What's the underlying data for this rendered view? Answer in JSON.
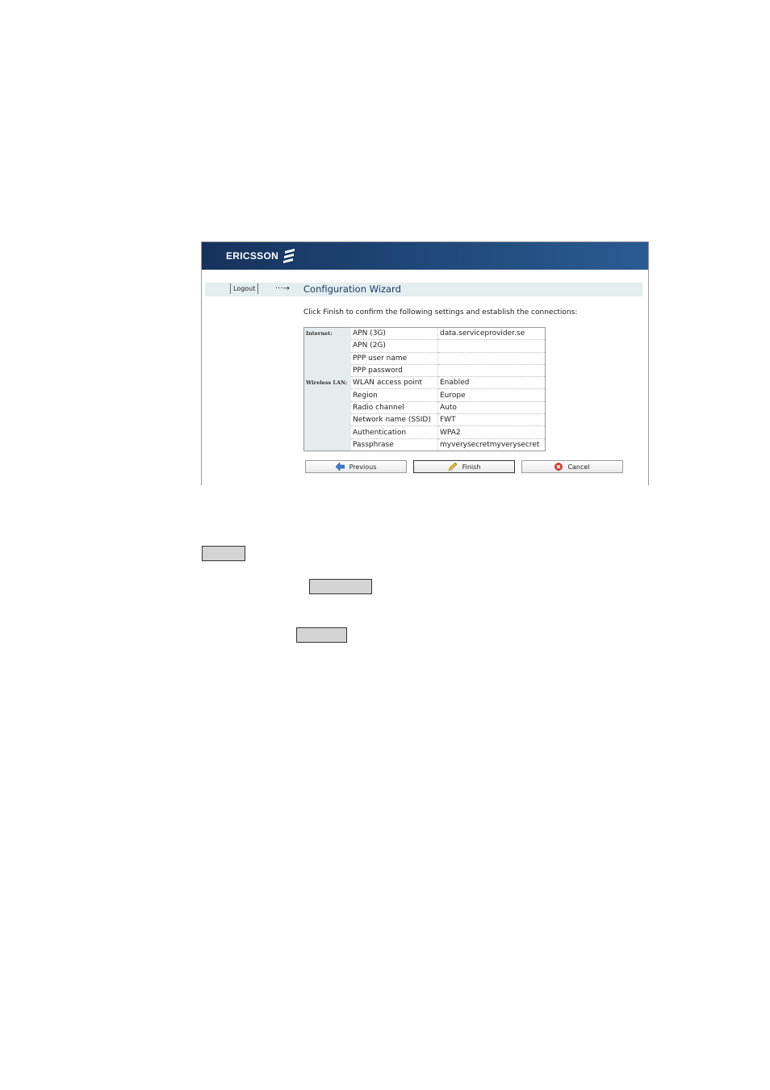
{
  "header": {
    "brand": "ERICSSON"
  },
  "nav": {
    "logout_label": "Logout",
    "arrow": "···→",
    "title": "Configuration Wizard"
  },
  "instructions": "Click Finish to confirm the following settings and establish the connections:",
  "sections": {
    "internet": "Internet:",
    "wireless": "Wireless LAN:"
  },
  "rows": [
    {
      "label": "APN (3G)",
      "value": "data.serviceprovider.se"
    },
    {
      "label": "APN (2G)",
      "value": ""
    },
    {
      "label": "PPP user name",
      "value": ""
    },
    {
      "label": "PPP password",
      "value": ""
    },
    {
      "label": "WLAN access point",
      "value": "Enabled"
    },
    {
      "label": "Region",
      "value": "Europe"
    },
    {
      "label": "Radio channel",
      "value": "Auto"
    },
    {
      "label": "Network name (SSID)",
      "value": "FWT"
    },
    {
      "label": "Authentication",
      "value": "WPA2"
    },
    {
      "label": "Passphrase",
      "value": "myverysecretmyverysecret"
    }
  ],
  "buttons": {
    "previous": "Previous",
    "finish": "Finish",
    "cancel": "Cancel"
  },
  "icons": {
    "previous": "arrow-left-icon",
    "finish": "pencil-icon",
    "cancel": "cancel-icon"
  },
  "colors": {
    "banner": "#1e4676",
    "title": "#1d3a6c",
    "navbar": "#e3eeee"
  }
}
